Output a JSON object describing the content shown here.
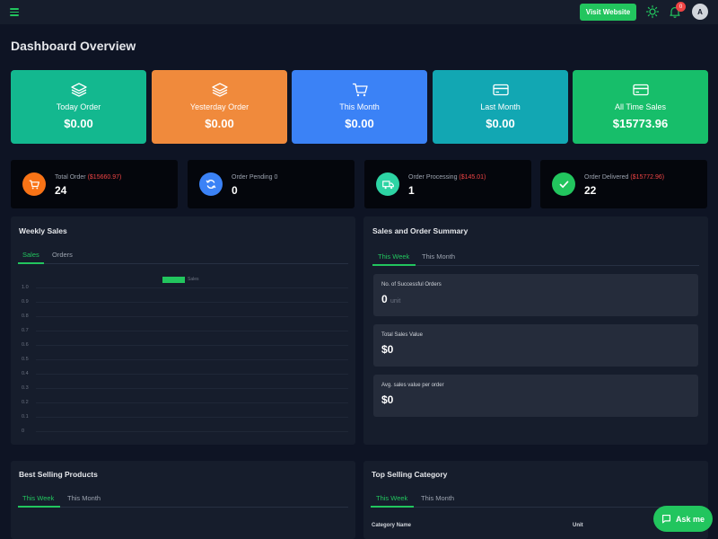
{
  "header": {
    "visit_website": "Visit Website",
    "notification_count": "0",
    "avatar_initial": "A"
  },
  "page_title": "Dashboard Overview",
  "stat_cards": [
    {
      "label": "Today Order",
      "value": "$0.00",
      "color": "#13b88f",
      "icon": "layers-icon"
    },
    {
      "label": "Yesterday Order",
      "value": "$0.00",
      "color": "#f08a3c",
      "icon": "layers-icon"
    },
    {
      "label": "This Month",
      "value": "$0.00",
      "color": "#3b82f6",
      "icon": "cart-icon"
    },
    {
      "label": "Last Month",
      "value": "$0.00",
      "color": "#12a7b3",
      "icon": "credit-card-icon"
    },
    {
      "label": "All Time Sales",
      "value": "$15773.96",
      "color": "#17be6a",
      "icon": "credit-card-icon"
    }
  ],
  "mini_cards": [
    {
      "label": "Total Order",
      "extra": "($15660.97)",
      "value": "24",
      "color": "#f97316",
      "icon": "cart-icon"
    },
    {
      "label": "Order Pending 0",
      "extra": "",
      "value": "0",
      "color": "#3b82f6",
      "icon": "refresh-icon"
    },
    {
      "label": "Order Processing",
      "extra": "($145.01)",
      "value": "1",
      "color": "#2dd4a4",
      "icon": "truck-icon"
    },
    {
      "label": "Order Delivered",
      "extra": "($15772.96)",
      "value": "22",
      "color": "#22c55e",
      "icon": "check-icon"
    }
  ],
  "weekly_sales": {
    "title": "Weekly Sales",
    "tabs": [
      "Sales",
      "Orders"
    ],
    "active_tab": "Sales",
    "legend": "Sales"
  },
  "chart_data": {
    "type": "line",
    "title": "Weekly Sales",
    "series": [
      {
        "name": "Sales",
        "values": []
      }
    ],
    "y_ticks": [
      "1.0",
      "0.9",
      "0.8",
      "0.7",
      "0.6",
      "0.5",
      "0.4",
      "0.3",
      "0.2",
      "0.1",
      "0"
    ],
    "ylim": [
      0,
      1.0
    ],
    "grid": true,
    "legend_position": "top"
  },
  "summary": {
    "title": "Sales and Order Summary",
    "tabs": [
      "This Week",
      "This Month"
    ],
    "boxes": [
      {
        "label": "No. of Successful Orders",
        "value": "0",
        "unit": "unit"
      },
      {
        "label": "Total Sales Value",
        "value": "$0",
        "unit": ""
      },
      {
        "label": "Avg. sales value per order",
        "value": "$0",
        "unit": ""
      }
    ]
  },
  "best_selling": {
    "title": "Best Selling Products",
    "tabs": [
      "This Week",
      "This Month"
    ]
  },
  "top_category": {
    "title": "Top Selling Category",
    "tabs": [
      "This Week",
      "This Month"
    ],
    "columns": [
      "Category Name",
      "Unit"
    ]
  },
  "ask_me": "Ask me"
}
